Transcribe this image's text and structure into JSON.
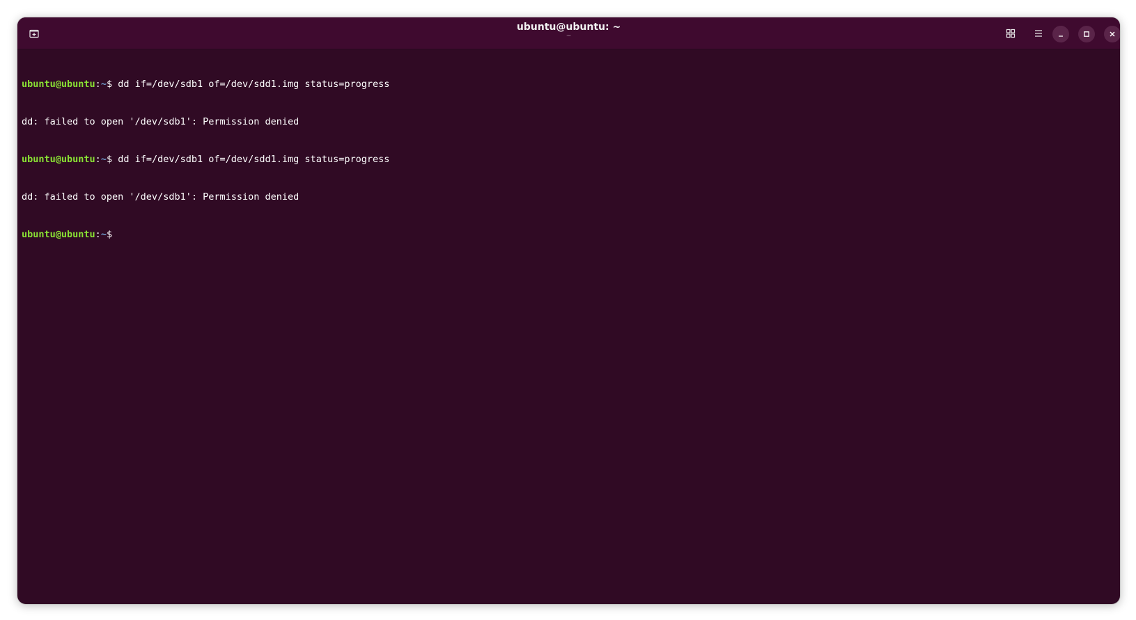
{
  "window": {
    "title": "ubuntu@ubuntu: ~",
    "subtitle": "~"
  },
  "icons": {
    "new_tab": "new-tab-icon",
    "view_tabs": "grid-icon",
    "menu": "hamburger-menu-icon",
    "minimize": "minimize-icon",
    "maximize": "maximize-icon",
    "close": "close-icon"
  },
  "colors": {
    "background": "#300a24",
    "titlebar": "#3f0a2f",
    "prompt_user": "#8ae234",
    "prompt_path": "#729fcf",
    "text": "#ffffff"
  },
  "terminal": {
    "lines": [
      {
        "user": "ubuntu@ubuntu",
        "sep": ":",
        "path": "~",
        "dollar": "$ ",
        "cmd": "dd if=/dev/sdb1 of=/dev/sdd1.img status=progress"
      },
      {
        "output": "dd: failed to open '/dev/sdb1': Permission denied"
      },
      {
        "user": "ubuntu@ubuntu",
        "sep": ":",
        "path": "~",
        "dollar": "$ ",
        "cmd": "dd if=/dev/sdb1 of=/dev/sdd1.img status=progress"
      },
      {
        "output": "dd: failed to open '/dev/sdb1': Permission denied"
      },
      {
        "user": "ubuntu@ubuntu",
        "sep": ":",
        "path": "~",
        "dollar": "$",
        "cmd": ""
      }
    ]
  }
}
